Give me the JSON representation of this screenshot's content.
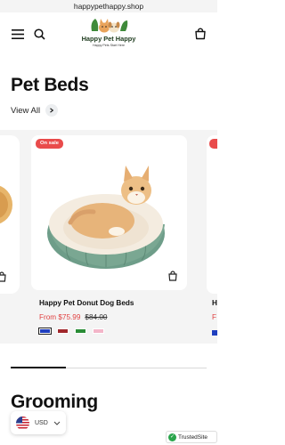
{
  "browser": {
    "url": "happypethappy.shop"
  },
  "header": {
    "logo_name": "Happy Pet Happy",
    "logo_tagline": "Happy Pets Start Here"
  },
  "section": {
    "title": "Pet Beds",
    "view_all": "View All"
  },
  "products": [
    {
      "badge": "On sale",
      "name": "Happy Pet Donut Dog Beds",
      "price": "From $75.99",
      "compare_price": "$84.00",
      "swatches": [
        "#1f3fbf",
        "#a0272b",
        "#2a8c36",
        "#f3b6c9"
      ]
    }
  ],
  "partial_right": {
    "name_initial": "H",
    "price_initial": "F"
  },
  "carousel_progress": 0.28,
  "next_section": {
    "title": "Grooming"
  },
  "currency": {
    "code": "USD"
  },
  "trust_badge": {
    "label": "TrustedSite"
  },
  "colors": {
    "sale": "#e04141",
    "badge_bg": "#e94b4b",
    "bed_green": "#7aa792",
    "bed_cream": "#f4ece0"
  }
}
